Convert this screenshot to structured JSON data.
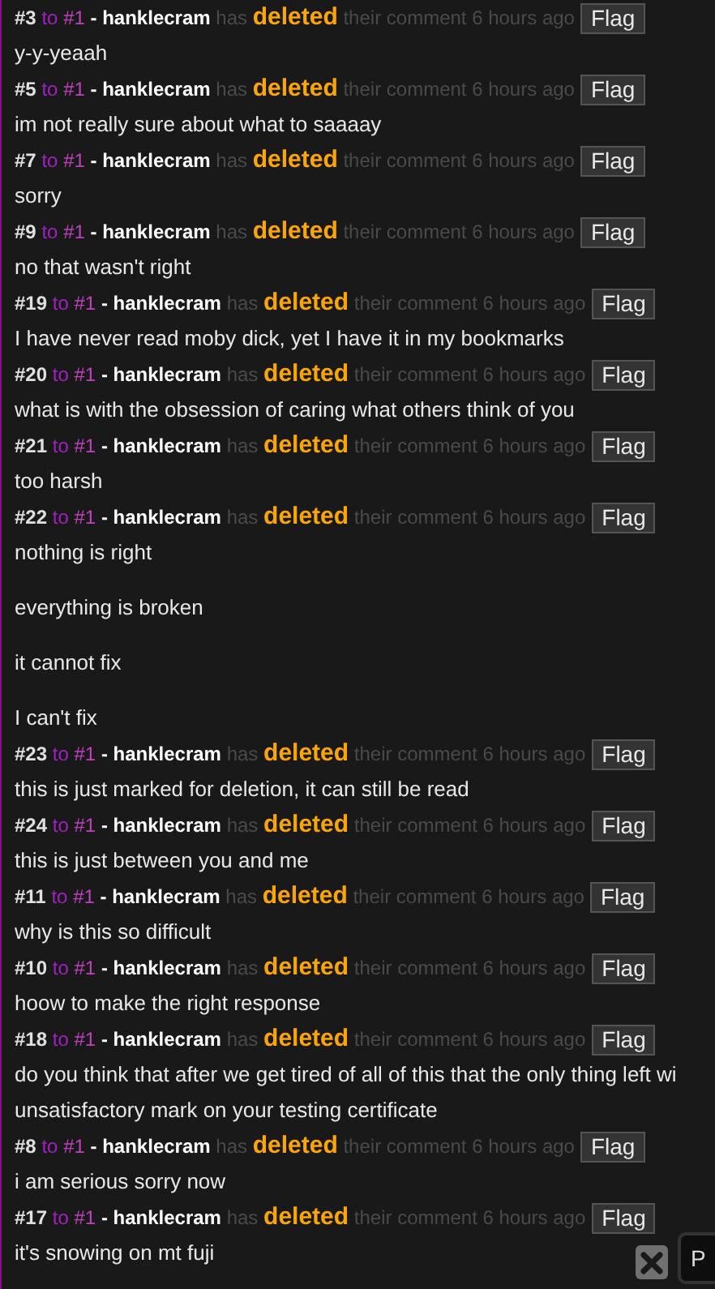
{
  "comments": [
    {
      "number": "#3",
      "to": "to",
      "target": "#1",
      "user": "- hanklecram",
      "verb": "has",
      "action": "deleted",
      "rest": "their comment 6 hours ago",
      "flag": "Flag",
      "paragraphs": [
        [
          "y-y-yeaah"
        ]
      ]
    },
    {
      "number": "#5",
      "to": "to",
      "target": "#1",
      "user": "- hanklecram",
      "verb": "has",
      "action": "deleted",
      "rest": "their comment 6 hours ago",
      "flag": "Flag",
      "paragraphs": [
        [
          "im not really sure about what to saaaay"
        ]
      ]
    },
    {
      "number": "#7",
      "to": "to",
      "target": "#1",
      "user": "- hanklecram",
      "verb": "has",
      "action": "deleted",
      "rest": "their comment 6 hours ago",
      "flag": "Flag",
      "paragraphs": [
        [
          "sorry"
        ]
      ]
    },
    {
      "number": "#9",
      "to": "to",
      "target": "#1",
      "user": "- hanklecram",
      "verb": "has",
      "action": "deleted",
      "rest": "their comment 6 hours ago",
      "flag": "Flag",
      "paragraphs": [
        [
          "no that wasn't right"
        ]
      ]
    },
    {
      "number": "#19",
      "to": "to",
      "target": "#1",
      "user": "- hanklecram",
      "verb": "has",
      "action": "deleted",
      "rest": "their comment 6 hours ago",
      "flag": "Flag",
      "paragraphs": [
        [
          "I have never read moby dick, yet I have it in my bookmarks"
        ]
      ]
    },
    {
      "number": "#20",
      "to": "to",
      "target": "#1",
      "user": "- hanklecram",
      "verb": "has",
      "action": "deleted",
      "rest": "their comment 6 hours ago",
      "flag": "Flag",
      "paragraphs": [
        [
          "what is with the obsession of caring what others think of you"
        ]
      ]
    },
    {
      "number": "#21",
      "to": "to",
      "target": "#1",
      "user": "- hanklecram",
      "verb": "has",
      "action": "deleted",
      "rest": "their comment 6 hours ago",
      "flag": "Flag",
      "paragraphs": [
        [
          "too harsh"
        ]
      ]
    },
    {
      "number": "#22",
      "to": "to",
      "target": "#1",
      "user": "- hanklecram",
      "verb": "has",
      "action": "deleted",
      "rest": "their comment 6 hours ago",
      "flag": "Flag",
      "paragraphs": [
        [
          "nothing is right"
        ],
        [
          "everything is broken"
        ],
        [
          "it cannot fix"
        ],
        [
          "I can't fix"
        ]
      ]
    },
    {
      "number": "#23",
      "to": "to",
      "target": "#1",
      "user": "- hanklecram",
      "verb": "has",
      "action": "deleted",
      "rest": "their comment 6 hours ago",
      "flag": "Flag",
      "paragraphs": [
        [
          "this is just marked for deletion, it can still be read"
        ]
      ]
    },
    {
      "number": "#24",
      "to": "to",
      "target": "#1",
      "user": "- hanklecram",
      "verb": "has",
      "action": "deleted",
      "rest": "their comment 6 hours ago",
      "flag": "Flag",
      "paragraphs": [
        [
          "this is just between you and me"
        ]
      ]
    },
    {
      "number": "#11",
      "to": "to",
      "target": "#1",
      "user": "- hanklecram",
      "verb": "has",
      "action": "deleted",
      "rest": "their comment 6 hours ago",
      "flag": "Flag",
      "paragraphs": [
        [
          "why is this so difficult"
        ]
      ]
    },
    {
      "number": "#10",
      "to": "to",
      "target": "#1",
      "user": "- hanklecram",
      "verb": "has",
      "action": "deleted",
      "rest": "their comment 6 hours ago",
      "flag": "Flag",
      "paragraphs": [
        [
          "hoow to make the right response"
        ]
      ]
    },
    {
      "number": "#18",
      "to": "to",
      "target": "#1",
      "user": "- hanklecram",
      "verb": "has",
      "action": "deleted",
      "rest": "their comment 6 hours ago",
      "flag": "Flag",
      "paragraphs": [
        [
          "do you think that after we get tired of all of this that the only thing left wi",
          "unsatisfactory mark on your testing certificate"
        ]
      ]
    },
    {
      "number": "#8",
      "to": "to",
      "target": "#1",
      "user": "- hanklecram",
      "verb": "has",
      "action": "deleted",
      "rest": "their comment 6 hours ago",
      "flag": "Flag",
      "paragraphs": [
        [
          "i am serious sorry now"
        ]
      ]
    },
    {
      "number": "#17",
      "to": "to",
      "target": "#1",
      "user": "- hanklecram",
      "verb": "has",
      "action": "deleted",
      "rest": "their comment 6 hours ago",
      "flag": "Flag",
      "paragraphs": [
        [
          "it's snowing on mt fuji"
        ]
      ]
    }
  ],
  "popup": {
    "label": "P"
  }
}
